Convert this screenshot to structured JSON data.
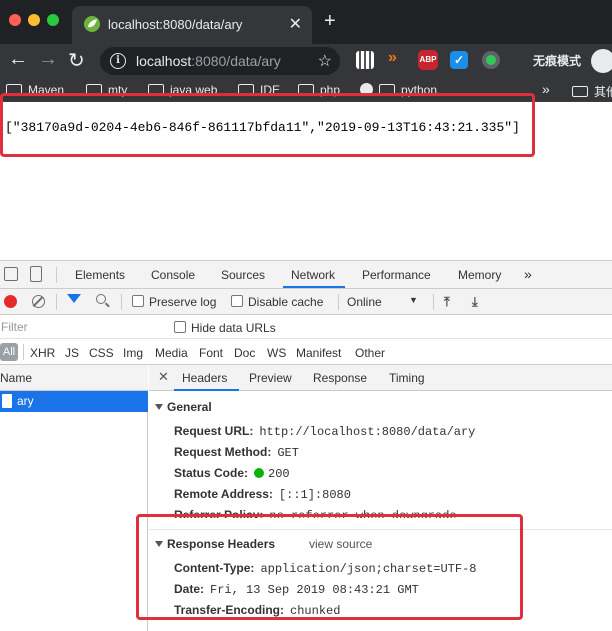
{
  "browser": {
    "tab_title": "localhost:8080/data/ary",
    "new_tab_label": "+",
    "url_host": "localhost",
    "url_rest": ":8080/data/ary",
    "incognito_label": "无痕模式",
    "extensions": [
      "qr-code-icon",
      "orange-chevron-icon",
      "adblock-icon",
      "vpn-icon",
      "green-dot-icon"
    ],
    "bookmarks": [
      "Maven",
      "mty",
      "java web",
      "IDE",
      "php",
      "python"
    ],
    "bookmarks_more": "»",
    "bookmarks_overflow": "其他"
  },
  "page": {
    "json_text": "[\"38170a9d-0204-4eb6-846f-861117bfda11\",\"2019-09-13T16:43:21.335\"]"
  },
  "devtools": {
    "tabs": [
      "Elements",
      "Console",
      "Sources",
      "Network",
      "Performance",
      "Memory"
    ],
    "tabs_more": "»",
    "active_tab": "Network",
    "network_toolbar": {
      "preserve_log": "Preserve log",
      "disable_cache": "Disable cache",
      "throttling": "Online"
    },
    "filter_placeholder": "Filter",
    "hide_data_urls": "Hide data URLs",
    "type_filters": [
      "All",
      "XHR",
      "JS",
      "CSS",
      "Img",
      "Media",
      "Font",
      "Doc",
      "WS",
      "Manifest",
      "Other"
    ],
    "name_header": "Name",
    "request_name": "ary",
    "detail_tabs": [
      "Headers",
      "Preview",
      "Response",
      "Timing"
    ],
    "general": {
      "title": "General",
      "rows": [
        {
          "key": "Request URL:",
          "value": "http://localhost:8080/data/ary"
        },
        {
          "key": "Request Method:",
          "value": "GET"
        },
        {
          "key": "Status Code:",
          "value": "200"
        },
        {
          "key": "Remote Address:",
          "value": "[::1]:8080"
        },
        {
          "key": "Referrer Policy:",
          "value": "no-referrer-when-downgrade"
        }
      ]
    },
    "response_headers": {
      "title": "Response Headers",
      "view_source": "view source",
      "rows": [
        {
          "key": "Content-Type:",
          "value": "application/json;charset=UTF-8"
        },
        {
          "key": "Date:",
          "value": "Fri, 13 Sep 2019 08:43:21 GMT"
        },
        {
          "key": "Transfer-Encoding:",
          "value": "chunked"
        }
      ]
    }
  },
  "colors": {
    "highlight_box": "#e02e3c",
    "selected_row": "#1a73e8",
    "status_ok": "#0cb20c"
  }
}
